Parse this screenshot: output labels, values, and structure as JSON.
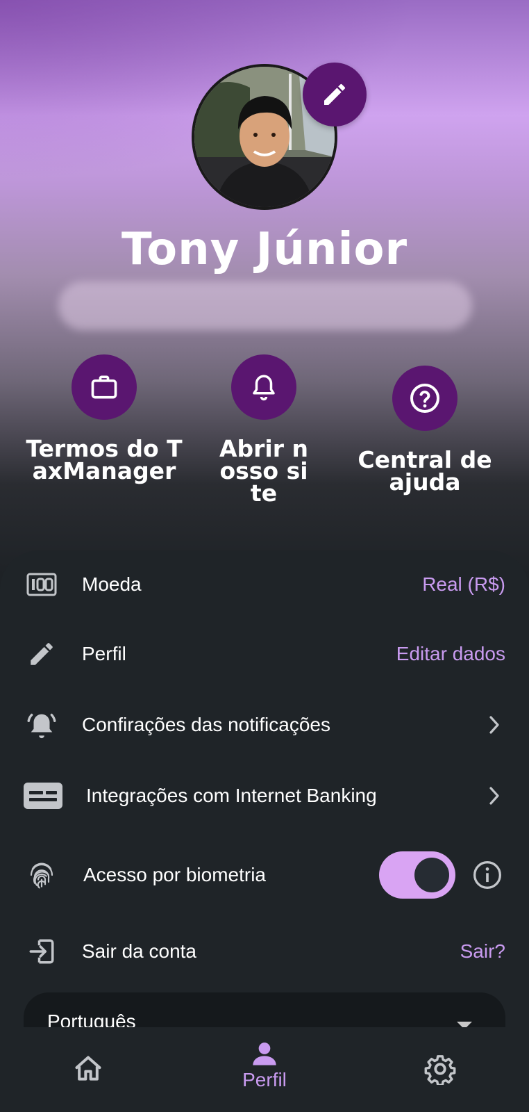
{
  "profile": {
    "name": "Tony Júnior"
  },
  "quick_actions": [
    {
      "label": "Termos do TaxManager",
      "icon": "briefcase-icon"
    },
    {
      "label": "Abrir nosso site",
      "icon": "bell-icon"
    },
    {
      "label": "Central de ajuda",
      "icon": "help-circle-icon"
    }
  ],
  "settings": {
    "currency": {
      "label": "Moeda",
      "value": "Real (R$)",
      "icon": "currency-icon"
    },
    "profile": {
      "label": "Perfil",
      "value": "Editar dados",
      "icon": "pencil-icon"
    },
    "notifications": {
      "label": "Confirações das notificações",
      "icon": "alarm-bell-icon"
    },
    "banking": {
      "label": "Integrações com Internet Banking",
      "icon": "bank-card-icon"
    },
    "biometrics": {
      "label": "Acesso por biometria",
      "enabled": true,
      "icon": "fingerprint-icon"
    },
    "logout": {
      "label": "Sair da conta",
      "value": "Sair?",
      "icon": "logout-icon"
    }
  },
  "language": {
    "selected": "Português"
  },
  "nav": {
    "home_icon": "home-icon",
    "profile_label": "Perfil",
    "settings_icon": "gear-icon"
  },
  "colors": {
    "accent": "#c99bf0",
    "brand_purple": "#5a1670",
    "panel_bg": "#1f2428",
    "toggle_on": "#d9a4f3"
  }
}
